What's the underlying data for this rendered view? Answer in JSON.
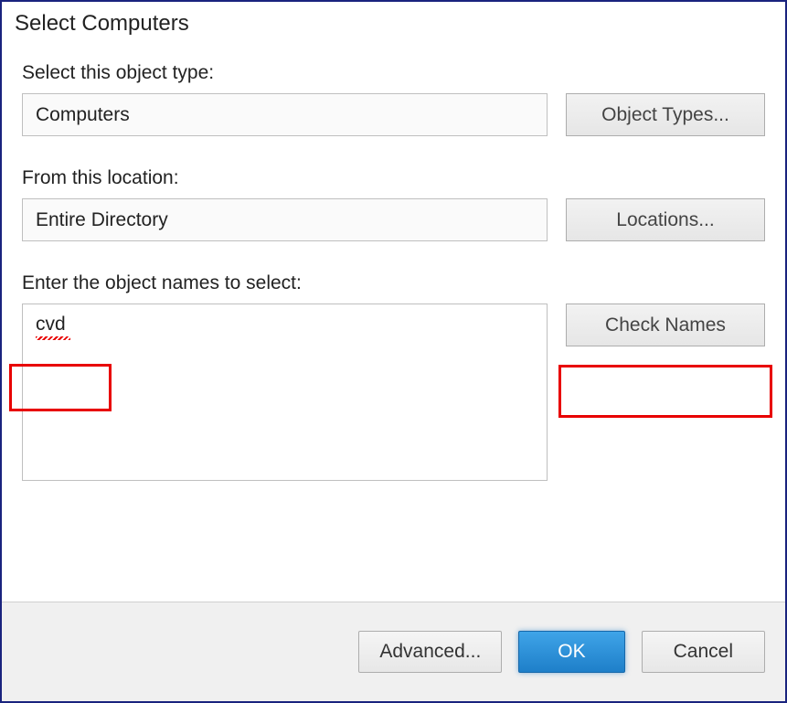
{
  "title": "Select Computers",
  "object_type": {
    "label": "Select this object type:",
    "value": "Computers",
    "button": "Object Types..."
  },
  "location": {
    "label": "From this location:",
    "value": "Entire Directory",
    "button": "Locations..."
  },
  "object_names": {
    "label": "Enter the object names to select:",
    "value": "cvd",
    "button": "Check Names"
  },
  "footer": {
    "advanced": "Advanced...",
    "ok": "OK",
    "cancel": "Cancel"
  }
}
